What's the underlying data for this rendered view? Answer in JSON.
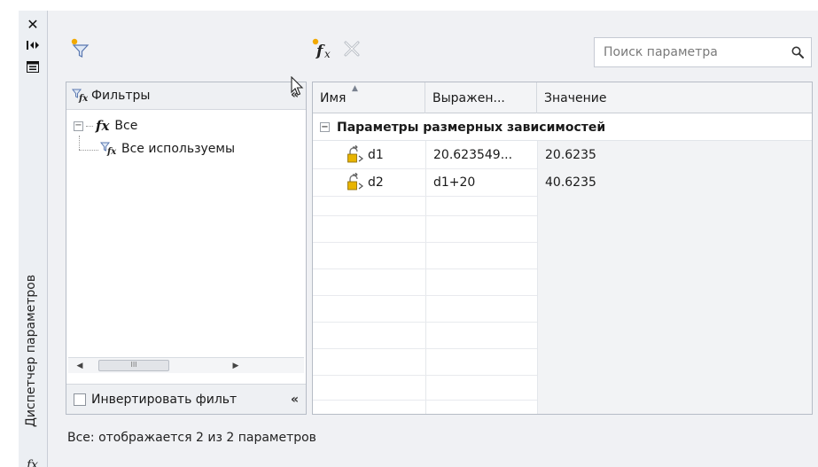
{
  "strip": {
    "title": "Диспетчер параметров",
    "close_glyph": "✕",
    "icons": [
      "close-icon",
      "autohide-icon",
      "properties-icon",
      "fx-icon"
    ]
  },
  "toolbar": {
    "icons": [
      "new-filter-icon",
      "new-parameter-icon",
      "delete-icon"
    ],
    "search": {
      "placeholder": "Поиск параметра",
      "icon": "search-icon"
    }
  },
  "filters": {
    "header": "Фильтры",
    "collapse_glyph": "«",
    "tree": [
      {
        "label": "Все",
        "expander": "−"
      },
      {
        "label": "Все используемы"
      }
    ],
    "scroll_thumb": "III",
    "invert_label": "Инвертировать фильт"
  },
  "grid": {
    "columns": [
      "Имя",
      "Выражен...",
      "Значение"
    ],
    "sort_glyph": "▲",
    "group": {
      "expander": "−",
      "label": "Параметры размерных зависимостей"
    },
    "rows": [
      {
        "name": "d1",
        "expression": "20.623549...",
        "value": "20.6235"
      },
      {
        "name": "d2",
        "expression": "d1+20",
        "value": "40.6235"
      }
    ]
  },
  "status": "Все: отображается 2 из 2 параметров",
  "colors": {
    "panel_bg": "#f0f1f4",
    "border": "#b6bcc6",
    "lock_yellow": "#e8b400",
    "accent_blue": "#5a78b0"
  }
}
